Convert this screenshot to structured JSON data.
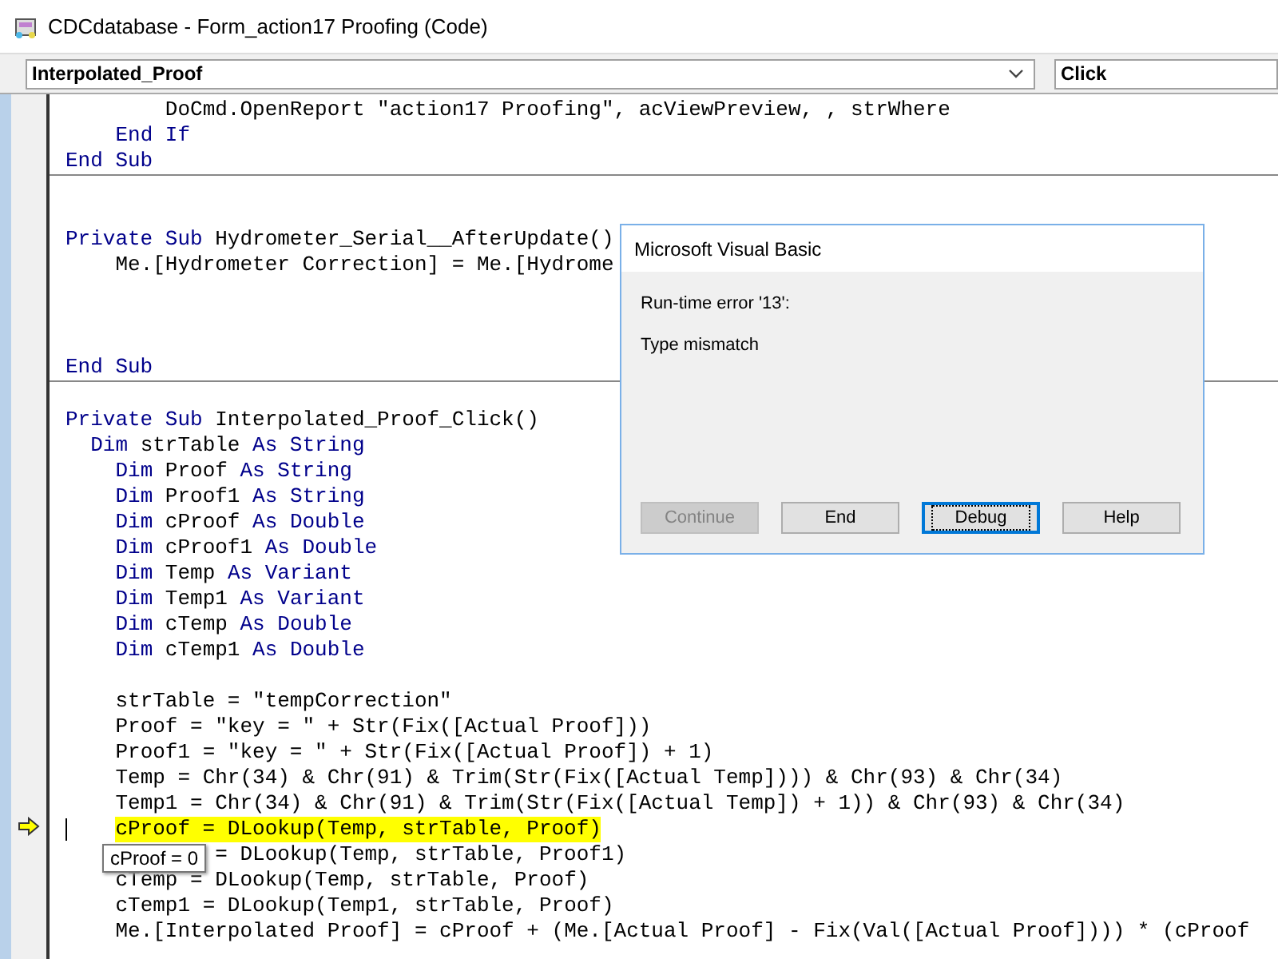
{
  "window": {
    "title": "CDCdatabase - Form_action17 Proofing (Code)"
  },
  "object_box": {
    "value": "Interpolated_Proof"
  },
  "procedure_box": {
    "value": "Click"
  },
  "procedures": [
    {
      "lines": [
        {
          "kind": "code",
          "segments": [
            {
              "text": "        DoCmd.OpenReport \"action17 Proofing\", acViewPreview, , strWhere",
              "kind": "plain"
            }
          ]
        },
        {
          "kind": "code",
          "segments": [
            {
              "text": "    End If",
              "kind": "keyword"
            }
          ]
        },
        {
          "kind": "code",
          "segments": [
            {
              "text": "End Sub",
              "kind": "keyword"
            }
          ]
        }
      ]
    },
    {
      "lines": [
        {
          "kind": "blank"
        },
        {
          "kind": "blank"
        },
        {
          "kind": "code",
          "segments": [
            {
              "text": "Private Sub",
              "kind": "keyword"
            },
            {
              "text": " Hydrometer_Serial__AfterUpdate()",
              "kind": "plain"
            }
          ]
        },
        {
          "kind": "code",
          "segments": [
            {
              "text": "    Me.[Hydrometer Correction] = Me.[Hydrome",
              "kind": "plain"
            }
          ]
        },
        {
          "kind": "blank"
        },
        {
          "kind": "blank"
        },
        {
          "kind": "blank"
        },
        {
          "kind": "code",
          "segments": [
            {
              "text": "End Sub",
              "kind": "keyword"
            }
          ]
        }
      ]
    },
    {
      "lines": [
        {
          "kind": "blank"
        },
        {
          "kind": "code",
          "segments": [
            {
              "text": "Private Sub",
              "kind": "keyword"
            },
            {
              "text": " Interpolated_Proof_Click()",
              "kind": "plain"
            }
          ]
        },
        {
          "kind": "code",
          "segments": [
            {
              "text": "  Dim",
              "kind": "keyword"
            },
            {
              "text": " strTable ",
              "kind": "plain"
            },
            {
              "text": "As String",
              "kind": "keyword"
            }
          ]
        },
        {
          "kind": "code",
          "segments": [
            {
              "text": "    Dim",
              "kind": "keyword"
            },
            {
              "text": " Proof ",
              "kind": "plain"
            },
            {
              "text": "As String",
              "kind": "keyword"
            }
          ]
        },
        {
          "kind": "code",
          "segments": [
            {
              "text": "    Dim",
              "kind": "keyword"
            },
            {
              "text": " Proof1 ",
              "kind": "plain"
            },
            {
              "text": "As String",
              "kind": "keyword"
            }
          ]
        },
        {
          "kind": "code",
          "segments": [
            {
              "text": "    Dim",
              "kind": "keyword"
            },
            {
              "text": " cProof ",
              "kind": "plain"
            },
            {
              "text": "As Double",
              "kind": "keyword"
            }
          ]
        },
        {
          "kind": "code",
          "segments": [
            {
              "text": "    Dim",
              "kind": "keyword"
            },
            {
              "text": " cProof1 ",
              "kind": "plain"
            },
            {
              "text": "As Double",
              "kind": "keyword"
            }
          ]
        },
        {
          "kind": "code",
          "segments": [
            {
              "text": "    Dim",
              "kind": "keyword"
            },
            {
              "text": " Temp ",
              "kind": "plain"
            },
            {
              "text": "As Variant",
              "kind": "keyword"
            }
          ]
        },
        {
          "kind": "code",
          "segments": [
            {
              "text": "    Dim",
              "kind": "keyword"
            },
            {
              "text": " Temp1 ",
              "kind": "plain"
            },
            {
              "text": "As Variant",
              "kind": "keyword"
            }
          ]
        },
        {
          "kind": "code",
          "segments": [
            {
              "text": "    Dim",
              "kind": "keyword"
            },
            {
              "text": " cTemp ",
              "kind": "plain"
            },
            {
              "text": "As Double",
              "kind": "keyword"
            }
          ]
        },
        {
          "kind": "code",
          "segments": [
            {
              "text": "    Dim",
              "kind": "keyword"
            },
            {
              "text": " cTemp1 ",
              "kind": "plain"
            },
            {
              "text": "As Double",
              "kind": "keyword"
            }
          ]
        },
        {
          "kind": "blank"
        },
        {
          "kind": "code",
          "segments": [
            {
              "text": "    strTable = \"tempCorrection\"",
              "kind": "plain"
            }
          ]
        },
        {
          "kind": "code",
          "segments": [
            {
              "text": "    Proof = \"key = \" + Str(Fix([Actual Proof]))",
              "kind": "plain"
            }
          ]
        },
        {
          "kind": "code",
          "segments": [
            {
              "text": "    Proof1 = \"key = \" + Str(Fix([Actual Proof]) + 1)",
              "kind": "plain"
            }
          ]
        },
        {
          "kind": "code",
          "segments": [
            {
              "text": "    Temp = Chr(34) & Chr(91) & Trim(Str(Fix([Actual Temp]))) & Chr(93) & Chr(34)",
              "kind": "plain"
            }
          ]
        },
        {
          "kind": "code",
          "segments": [
            {
              "text": "    Temp1 = Chr(34) & Chr(91) & Trim(Str(Fix([Actual Temp]) + 1)) & Chr(93) & Chr(34)",
              "kind": "plain"
            }
          ]
        },
        {
          "kind": "execution_point",
          "text": "cProof = DLookup(Temp, strTable, Proof)"
        },
        {
          "kind": "code",
          "segments": [
            {
              "text": "            = DLookup(Temp, strTable, Proof1)",
              "kind": "plain"
            }
          ]
        },
        {
          "kind": "code",
          "segments": [
            {
              "text": "    cTemp = DLookup(Temp, strTable, Proof)",
              "kind": "plain"
            }
          ]
        },
        {
          "kind": "code",
          "segments": [
            {
              "text": "    cTemp1 = DLookup(Temp1, strTable, Proof)",
              "kind": "plain"
            }
          ]
        },
        {
          "kind": "code",
          "segments": [
            {
              "text": "    Me.[Interpolated Proof] = cProof + (Me.[Actual Proof] - Fix(Val([Actual Proof]))) * (cProof",
              "kind": "plain"
            }
          ]
        }
      ]
    }
  ],
  "tooltip": {
    "text": "cProof = 0"
  },
  "dialog": {
    "title": "Microsoft Visual Basic",
    "error": "Run-time error '13':",
    "message": "Type mismatch",
    "buttons": [
      {
        "label": "Continue",
        "disabled": true,
        "focused": false
      },
      {
        "label": "End",
        "disabled": false,
        "focused": false
      },
      {
        "label": "Debug",
        "disabled": false,
        "focused": true
      },
      {
        "label": "Help",
        "disabled": false,
        "focused": false
      }
    ]
  }
}
